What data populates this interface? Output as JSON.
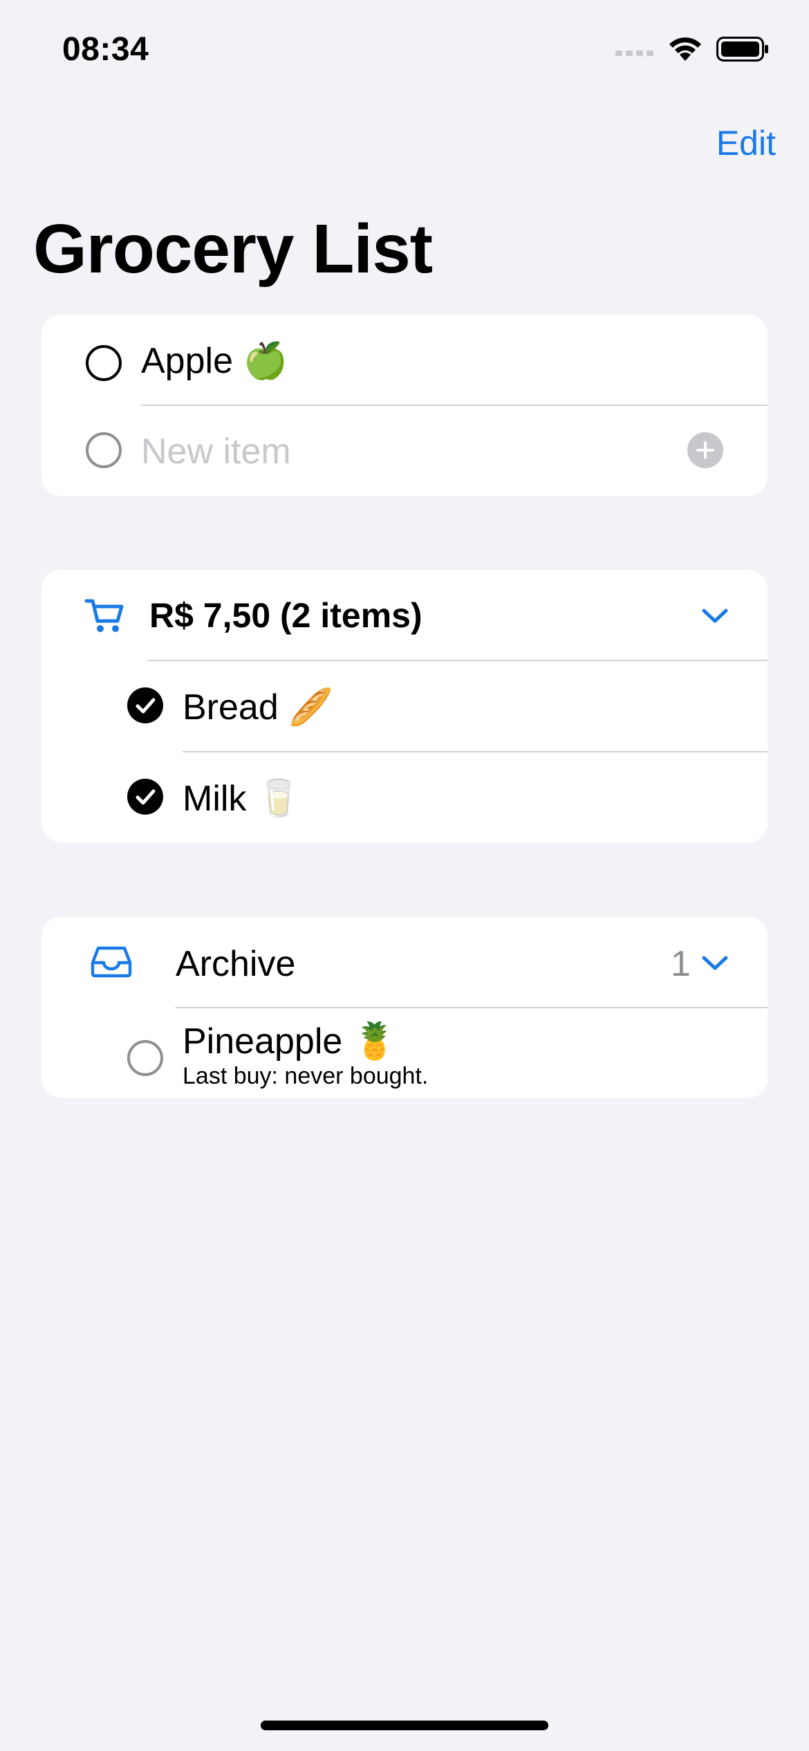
{
  "status_bar": {
    "time": "08:34",
    "icons": [
      "signal-icon",
      "wifi-icon",
      "battery-icon"
    ]
  },
  "nav": {
    "edit_label": "Edit",
    "title": "Grocery List"
  },
  "list": {
    "items": [
      {
        "name": "Apple 🍏",
        "checked": false
      }
    ],
    "new_item_placeholder": "New item"
  },
  "cart": {
    "summary": "R$ 7,50 (2 items)",
    "items": [
      {
        "name": "Bread 🥖",
        "checked": true
      },
      {
        "name": "Milk 🥛",
        "checked": true
      }
    ]
  },
  "archive": {
    "label": "Archive",
    "count": "1",
    "items": [
      {
        "name": "Pineapple 🍍",
        "subtitle": "Last buy: never bought.",
        "checked": false
      }
    ]
  },
  "colors": {
    "accent": "#1a7ae5",
    "background": "#f2f2f7",
    "card": "#ffffff",
    "separator": "#d1d1d6",
    "placeholder": "#c7c7cc"
  }
}
